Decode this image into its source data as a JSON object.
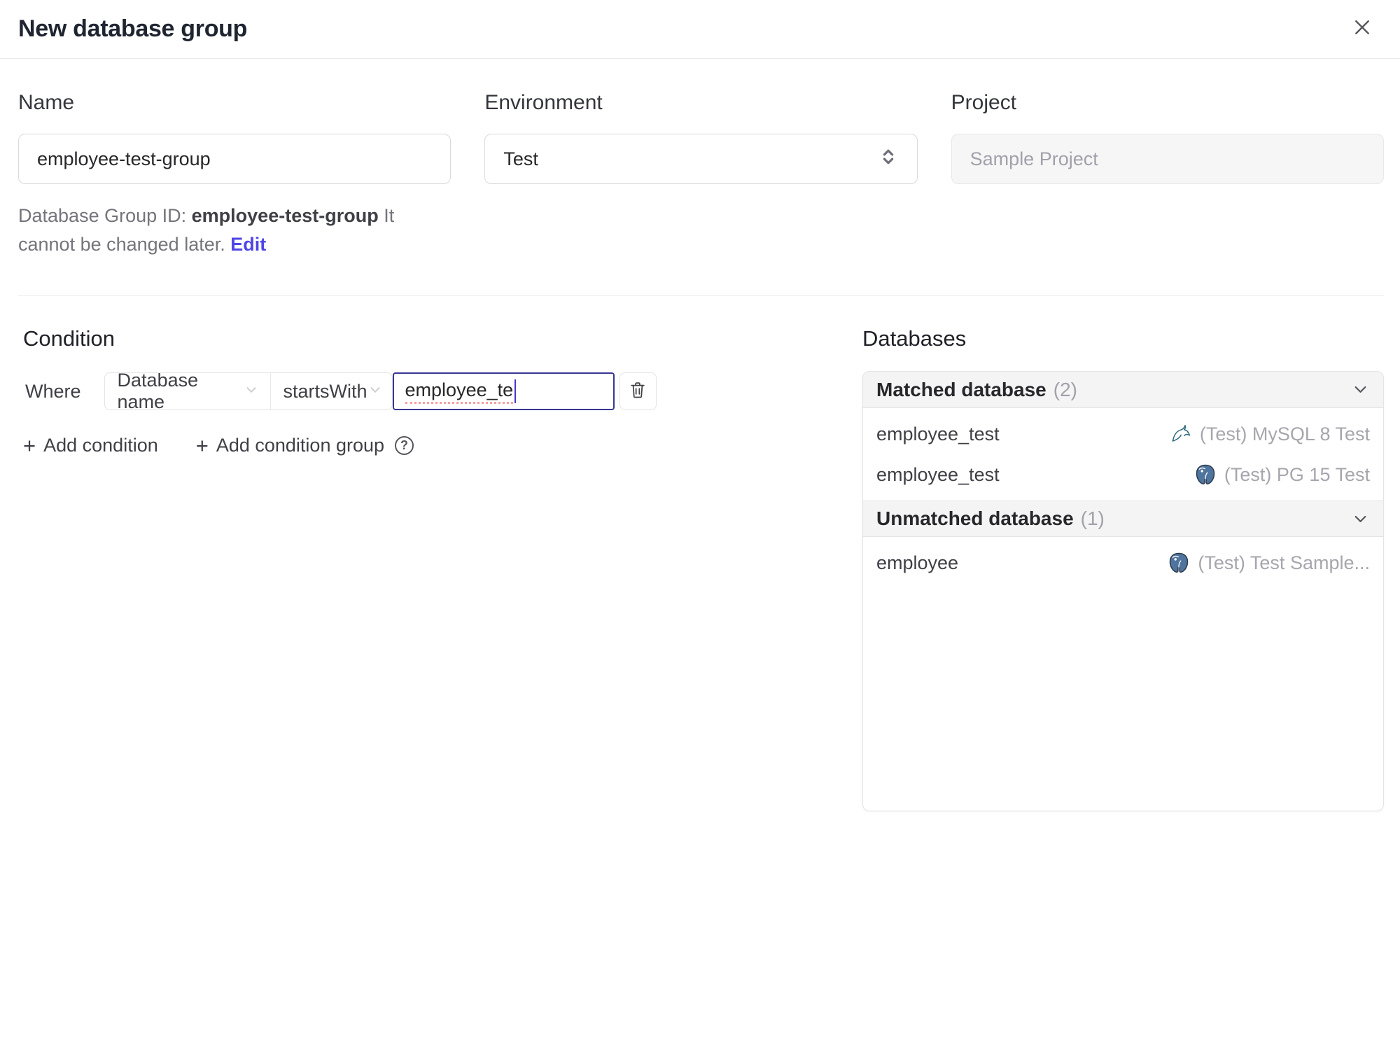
{
  "dialog": {
    "title": "New database group"
  },
  "form": {
    "name": {
      "label": "Name",
      "value": "employee-test-group"
    },
    "environment": {
      "label": "Environment",
      "value": "Test"
    },
    "project": {
      "label": "Project",
      "value": "Sample Project"
    },
    "helper": {
      "prefix": "Database Group ID:",
      "group_id": "employee-test-group",
      "suffix": "It cannot be changed later.",
      "edit_link": "Edit"
    }
  },
  "condition": {
    "heading": "Condition",
    "where_label": "Where",
    "field_selector": "Database name",
    "operator_selector": "startsWith",
    "value_input": "employee_te",
    "plus": "+",
    "add_condition_label": "Add condition",
    "add_condition_group_label": "Add condition group",
    "help_glyph": "?"
  },
  "databases": {
    "heading": "Databases",
    "groups": [
      {
        "title": "Matched database",
        "count": "(2)",
        "rows": [
          {
            "name": "employee_test",
            "engine": "mysql",
            "instance": "(Test) MySQL 8 Test"
          },
          {
            "name": "employee_test",
            "engine": "postgresql",
            "instance": "(Test) PG 15 Test"
          }
        ]
      },
      {
        "title": "Unmatched database",
        "count": "(1)",
        "rows": [
          {
            "name": "employee",
            "engine": "postgresql",
            "instance": "(Test) Test Sample..."
          }
        ]
      }
    ]
  },
  "colors": {
    "accent_link": "#4f46e5",
    "focused_input_border": "#3a3694",
    "spellcheck_underline": "#f05252",
    "group_header_bg": "#f4f4f5",
    "muted_text": "#a1a1aa",
    "mysql_icon": "#2d6a7f",
    "postgres_icon": "#4f749e"
  }
}
